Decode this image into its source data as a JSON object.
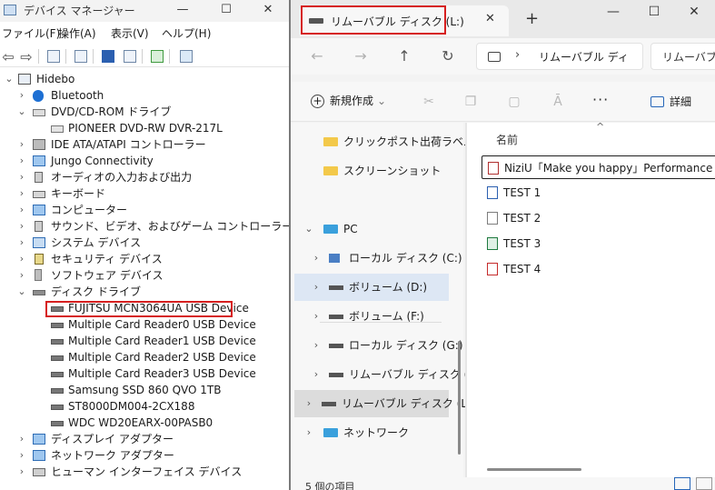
{
  "device_manager": {
    "title": "デバイス マネージャー",
    "window_buttons": {
      "minimize": "—",
      "maximize": "☐",
      "close": "✕"
    },
    "menus": [
      "ファイル(F)",
      "操作(A)",
      "表示(V)",
      "ヘルプ(H)"
    ],
    "tree": {
      "root": "Hidebo",
      "items": [
        {
          "label": "Bluetooth",
          "icon": "bluetooth-icon",
          "expanded": false
        },
        {
          "label": "DVD/CD-ROM ドライブ",
          "icon": "dvd-drive-icon",
          "expanded": true,
          "children": [
            "PIONEER DVD-RW  DVR-217L"
          ]
        },
        {
          "label": "IDE ATA/ATAPI コントローラー",
          "icon": "controller-icon",
          "expanded": false
        },
        {
          "label": "Jungo Connectivity",
          "icon": "monitor-icon",
          "expanded": false
        },
        {
          "label": "オーディオの入力および出力",
          "icon": "speaker-icon",
          "expanded": false
        },
        {
          "label": "キーボード",
          "icon": "keyboard-icon",
          "expanded": false
        },
        {
          "label": "コンピューター",
          "icon": "computer-icon",
          "expanded": false
        },
        {
          "label": "サウンド、ビデオ、およびゲーム コントローラー",
          "icon": "speaker-icon",
          "expanded": false
        },
        {
          "label": "システム デバイス",
          "icon": "folder-icon",
          "expanded": false
        },
        {
          "label": "セキュリティ デバイス",
          "icon": "lock-icon",
          "expanded": false
        },
        {
          "label": "ソフトウェア デバイス",
          "icon": "tower-icon",
          "expanded": false
        },
        {
          "label": "ディスク ドライブ",
          "icon": "disk-drive-icon",
          "expanded": true,
          "children": [
            "FUJITSU MCN3064UA USB Device",
            "Multiple Card Reader0 USB Device",
            "Multiple Card Reader1 USB Device",
            "Multiple Card Reader2 USB Device",
            "Multiple Card Reader3 USB Device",
            "Samsung SSD 860 QVO 1TB",
            "ST8000DM004-2CX188",
            "WDC WD20EARX-00PASB0"
          ]
        },
        {
          "label": "ディスプレイ アダプター",
          "icon": "display-icon",
          "expanded": false
        },
        {
          "label": "ネットワーク アダプター",
          "icon": "network-icon",
          "expanded": false
        },
        {
          "label": "ヒューマン インターフェイス デバイス",
          "icon": "hid-icon",
          "expanded": false
        }
      ]
    }
  },
  "explorer": {
    "tab_title": "リムーバブル ディスク (L:)",
    "tab_close": "✕",
    "new_tab": "+",
    "window_buttons": {
      "minimize": "—",
      "maximize": "☐",
      "close": "✕"
    },
    "nav": {
      "back": "←",
      "forward": "→",
      "up": "↑",
      "refresh": "↻"
    },
    "address_path": "リムーバブル ディ",
    "search_text": "リムーバブル",
    "command_bar": {
      "new_label": "新規作成",
      "more": "···",
      "details_label": "詳細"
    },
    "nav_pane": {
      "quick_access": [
        "クリックポスト出荷ラベル",
        "スクリーンショット"
      ],
      "pc_label": "PC",
      "drives": [
        {
          "label": "ローカル ディスク (C:)",
          "state": ""
        },
        {
          "label": "ボリューム (D:)",
          "state": "hover"
        },
        {
          "label": "ボリューム (F:)",
          "state": ""
        },
        {
          "label": "ローカル ディスク (G:)",
          "state": ""
        },
        {
          "label": "リムーバブル ディスク (L:)",
          "state": ""
        },
        {
          "label": "リムーバブル ディスク (L:)",
          "state": "selected"
        }
      ],
      "network_label": "ネットワーク"
    },
    "file_list": {
      "column_name": "名前",
      "sort_caret": "^",
      "files": [
        {
          "name": "NiziU「Make you happy」Performance Vi...",
          "icon": "video-file-icon"
        },
        {
          "name": "TEST 1",
          "icon": "word-file-icon"
        },
        {
          "name": "TEST 2",
          "icon": "text-file-icon"
        },
        {
          "name": "TEST 3",
          "icon": "excel-file-icon"
        },
        {
          "name": "TEST 4",
          "icon": "pdf-file-icon"
        }
      ]
    },
    "status": {
      "item_count": "5 個の項目"
    }
  },
  "colors": {
    "highlight_red": "#d61f1f",
    "selection_blue": "#dde7f4",
    "accent_blue": "#2465b8"
  }
}
